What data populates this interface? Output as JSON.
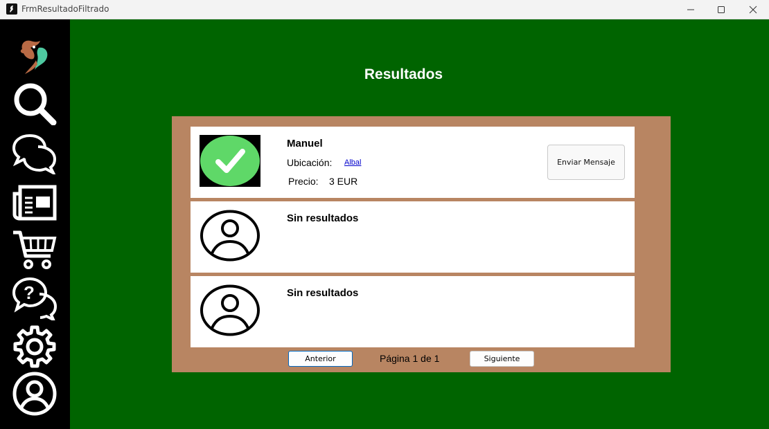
{
  "window": {
    "title": "FrmResultadoFiltrado",
    "controls": [
      "minimize-icon",
      "maximize-icon",
      "close-icon"
    ]
  },
  "sidebar": {
    "items": [
      {
        "name": "logo",
        "icon": "bird-logo-icon"
      },
      {
        "name": "search",
        "icon": "search-icon"
      },
      {
        "name": "chat",
        "icon": "chat-bubbles-icon"
      },
      {
        "name": "news",
        "icon": "newspaper-icon"
      },
      {
        "name": "cart",
        "icon": "shopping-cart-icon"
      },
      {
        "name": "help",
        "icon": "help-chat-icon"
      },
      {
        "name": "settings",
        "icon": "gear-icon"
      },
      {
        "name": "profile",
        "icon": "user-circle-icon"
      }
    ]
  },
  "main": {
    "title": "Resultados"
  },
  "results": [
    {
      "name": "Manuel",
      "location_label": "Ubicación:",
      "location": "Albal",
      "price_label": "Precio:",
      "price": "3 EUR",
      "action_label": "Enviar Mensaje",
      "icon": "check-circle-icon"
    },
    {
      "name": "Sin resultados",
      "icon": "user-circle-icon"
    },
    {
      "name": "Sin resultados",
      "icon": "user-circle-icon"
    }
  ],
  "pager": {
    "prev_label": "Anterior",
    "page_info": "Página 1 de 1",
    "next_label": "Siguiente"
  },
  "colors": {
    "background": "#006400",
    "sidebar": "#000000",
    "panel": "#b88562",
    "check": "#5fd868",
    "link": "#0000cc"
  }
}
